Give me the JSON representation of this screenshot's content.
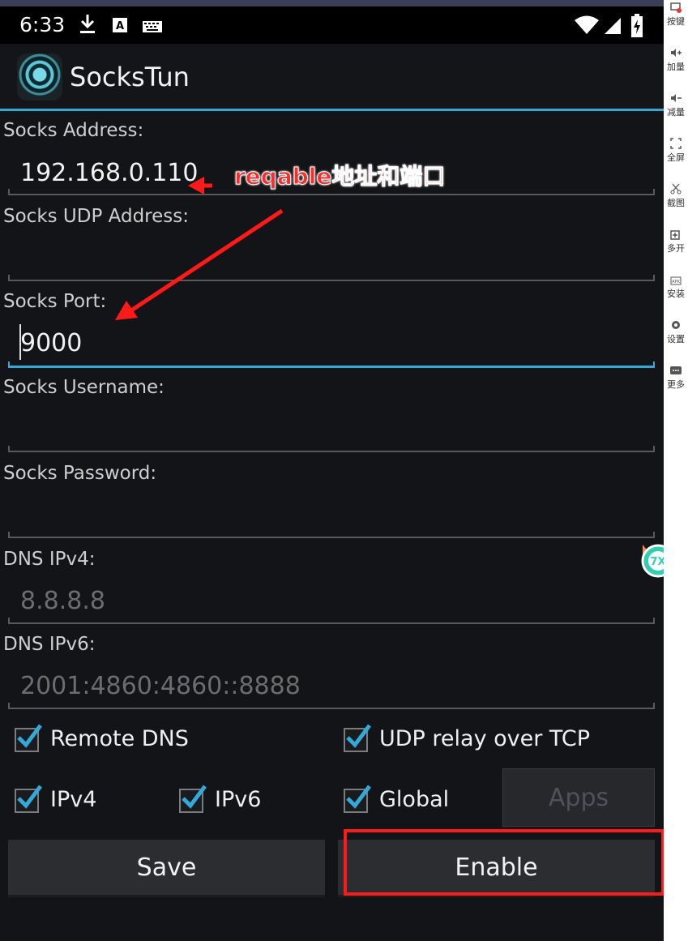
{
  "status_bar": {
    "time": "6:33"
  },
  "app": {
    "title": "SocksTun"
  },
  "form": {
    "socks_address": {
      "label": "Socks Address:",
      "value": "192.168.0.110"
    },
    "socks_udp_address": {
      "label": "Socks UDP Address:",
      "value": ""
    },
    "socks_port": {
      "label": "Socks Port:",
      "value": "9000"
    },
    "socks_username": {
      "label": "Socks Username:",
      "value": ""
    },
    "socks_password": {
      "label": "Socks Password:",
      "value": ""
    },
    "dns_ipv4": {
      "label": "DNS IPv4:",
      "placeholder": "8.8.8.8"
    },
    "dns_ipv6": {
      "label": "DNS IPv6:",
      "placeholder": "2001:4860:4860::8888"
    }
  },
  "options": {
    "remote_dns": {
      "label": "Remote DNS",
      "checked": true
    },
    "udp_relay": {
      "label": "UDP relay over TCP",
      "checked": true
    },
    "ipv4": {
      "label": "IPv4",
      "checked": true
    },
    "ipv6": {
      "label": "IPv6",
      "checked": true
    },
    "global": {
      "label": "Global",
      "checked": true
    }
  },
  "buttons": {
    "apps": "Apps",
    "save": "Save",
    "enable": "Enable"
  },
  "annotation": {
    "text": "reqable地址和端口",
    "color": "#ff2a2a"
  },
  "sidebar": {
    "items": [
      "按键",
      "加量",
      "减量",
      "全屏",
      "截图",
      "多开",
      "安装",
      "设置",
      "更多"
    ]
  },
  "colors": {
    "accent": "#33a9d9",
    "background": "#131417",
    "annotation_red": "#ff1a1a"
  }
}
